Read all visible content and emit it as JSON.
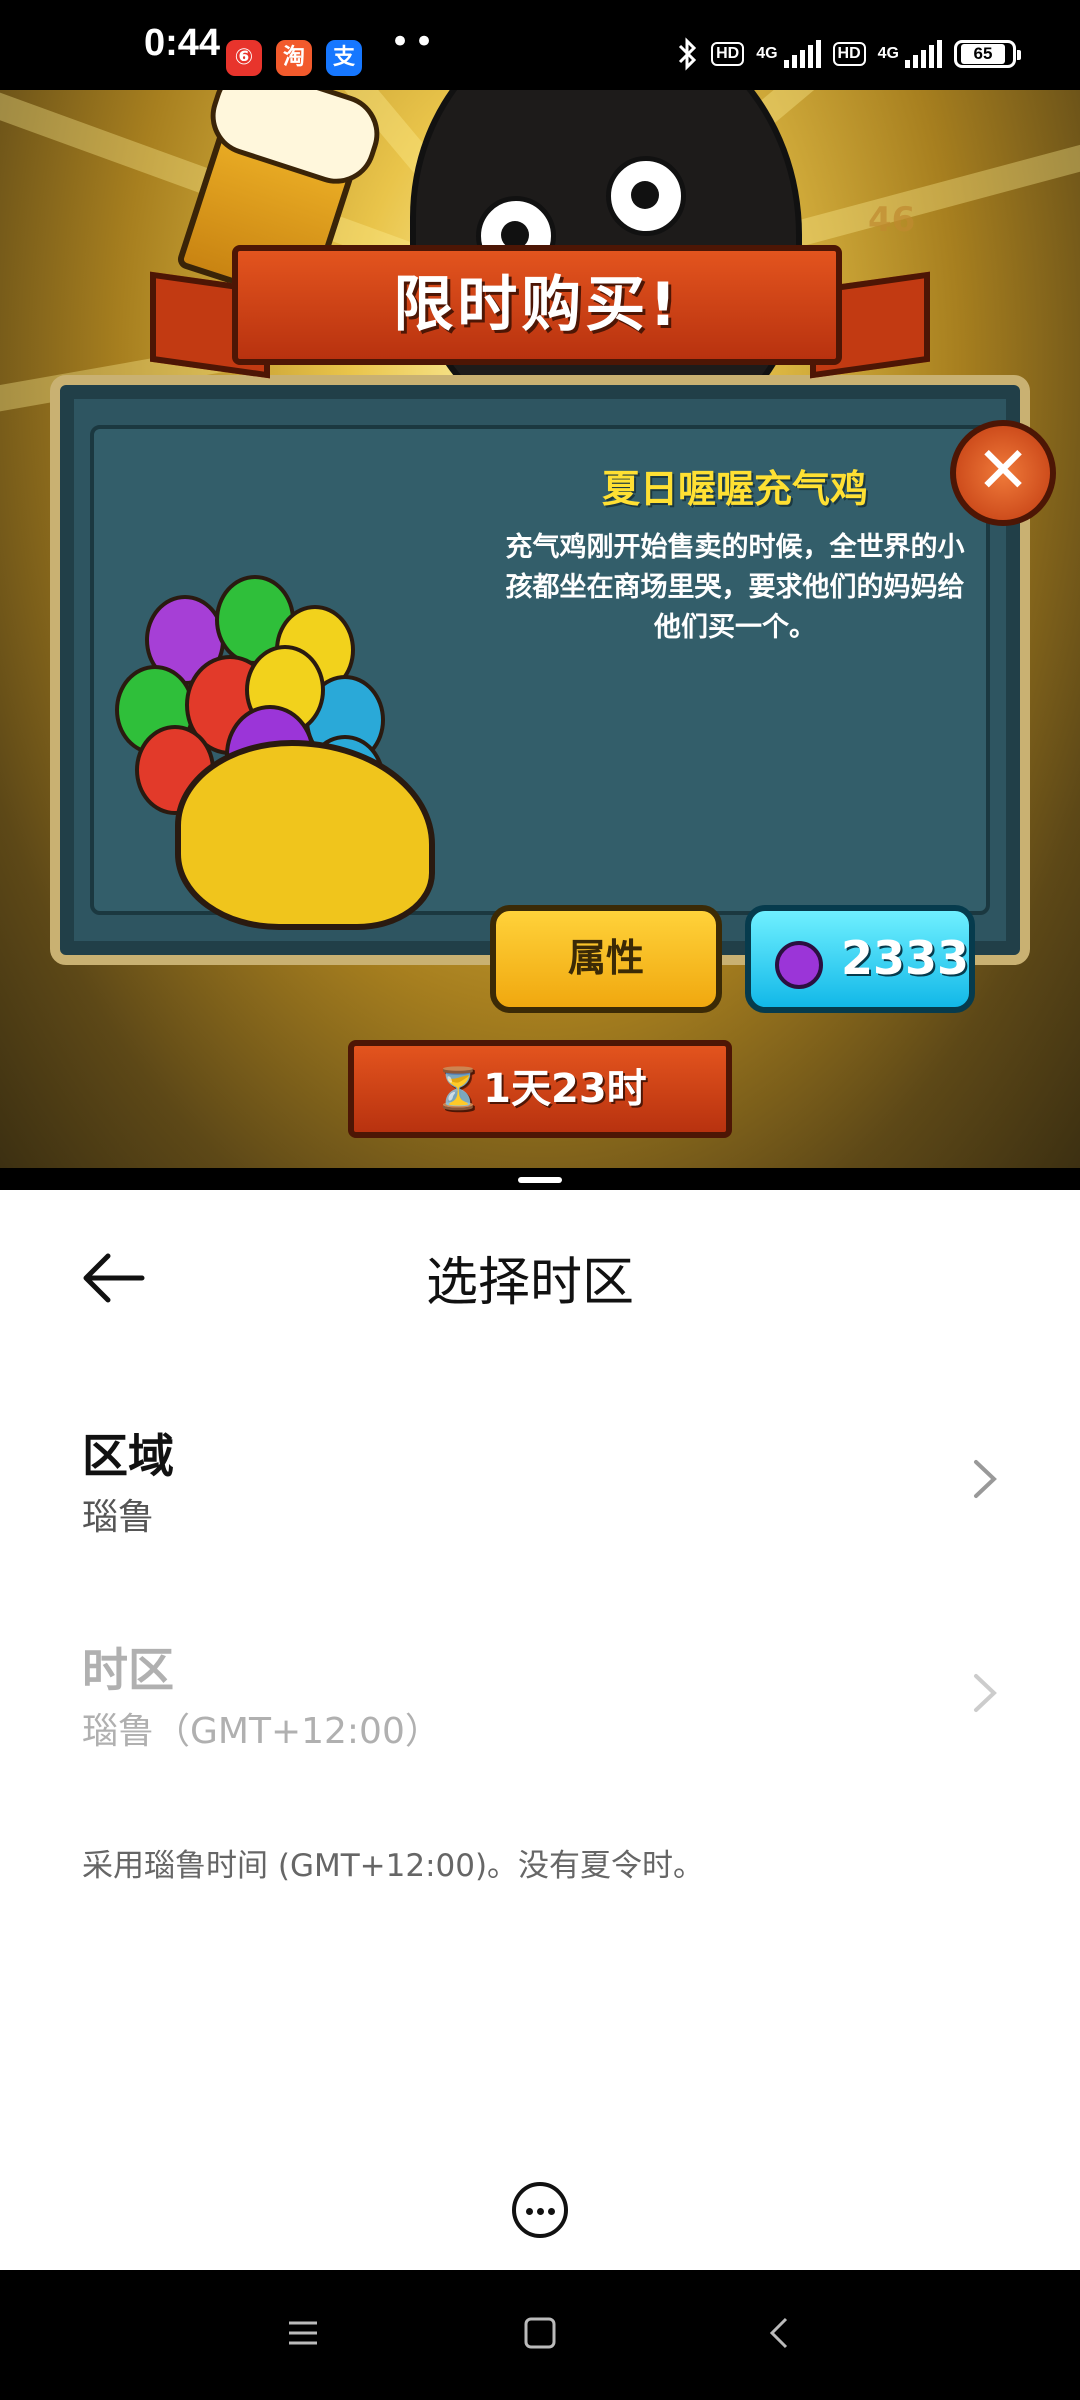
{
  "status_bar": {
    "time": "0:44",
    "apps": [
      "weibo-icon",
      "taobao-icon",
      "alipay-icon"
    ],
    "app_glyphs": [
      "⑥",
      "淘",
      "支"
    ],
    "dots": "••",
    "hd_label": "HD",
    "network": "4G",
    "battery": "65"
  },
  "game": {
    "dialog_title": "限时购买!",
    "item_name": "夏日喔喔充气鸡",
    "item_description": "充气鸡刚开始售卖的时候，全世界的小孩都坐在商场里哭，要求他们的妈妈给他们买一个。",
    "attributes_button": "属性",
    "price": "2333",
    "timer": "1天23时",
    "timer_glyph": "⏳",
    "close_glyph": "✕",
    "hud_count": "46"
  },
  "settings": {
    "title": "选择时区",
    "region_label": "区域",
    "region_value": "瑙鲁",
    "timezone_label": "时区",
    "timezone_value": "瑙鲁（GMT+12:00）",
    "note": "采用瑙鲁时间 (GMT+12:00)。没有夏令时。"
  },
  "colors": {
    "accent_gold": "#ffe033",
    "button_yellow": "#f0a80f",
    "button_cyan": "#12b8e8",
    "ribbon_red": "#c23a12",
    "dialog_teal": "#2e5561",
    "disabled_text": "#b0b0b0"
  }
}
